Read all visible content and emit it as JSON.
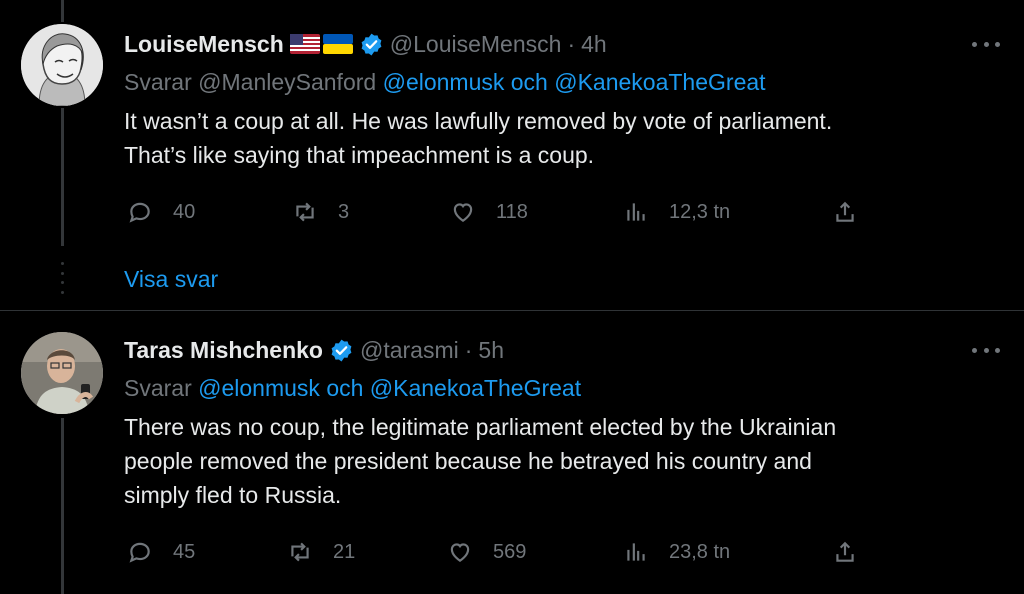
{
  "tweets": [
    {
      "display_name": "LouiseMensch",
      "handle": "@LouiseMensch",
      "separator": "·",
      "time": "4h",
      "flags": [
        "us-flag-icon",
        "ukraine-flag-icon"
      ],
      "reply_prefix": "Svarar",
      "reply_to_plain": "@ManleySanford",
      "reply_to_links": "@elonmusk och @KanekoaTheGreat",
      "body_lines": [
        "It wasn’t a coup at all. He was lawfully removed by vote of parliament.",
        "That’s like saying that impeachment is a coup."
      ],
      "replies": "40",
      "reposts": "3",
      "likes": "118",
      "views": "12,3 tn"
    },
    {
      "display_name": "Taras Mishchenko",
      "handle": "@tarasmi",
      "separator": "·",
      "time": "5h",
      "reply_prefix": "Svarar",
      "reply_to_links": "@elonmusk och @KanekoaTheGreat",
      "body_lines": [
        "There was no coup, the legitimate parliament elected by the Ukrainian",
        "people removed the president because he betrayed his country and",
        "simply fled to Russia."
      ],
      "replies": "45",
      "reposts": "21",
      "likes": "569",
      "views": "23,8 tn"
    }
  ],
  "show_replies_label": "Visa svar",
  "colors": {
    "background": "#000000",
    "text": "#e7e9ea",
    "muted": "#71767b",
    "link": "#1d9bf0",
    "verified": "#1d9bf0"
  }
}
